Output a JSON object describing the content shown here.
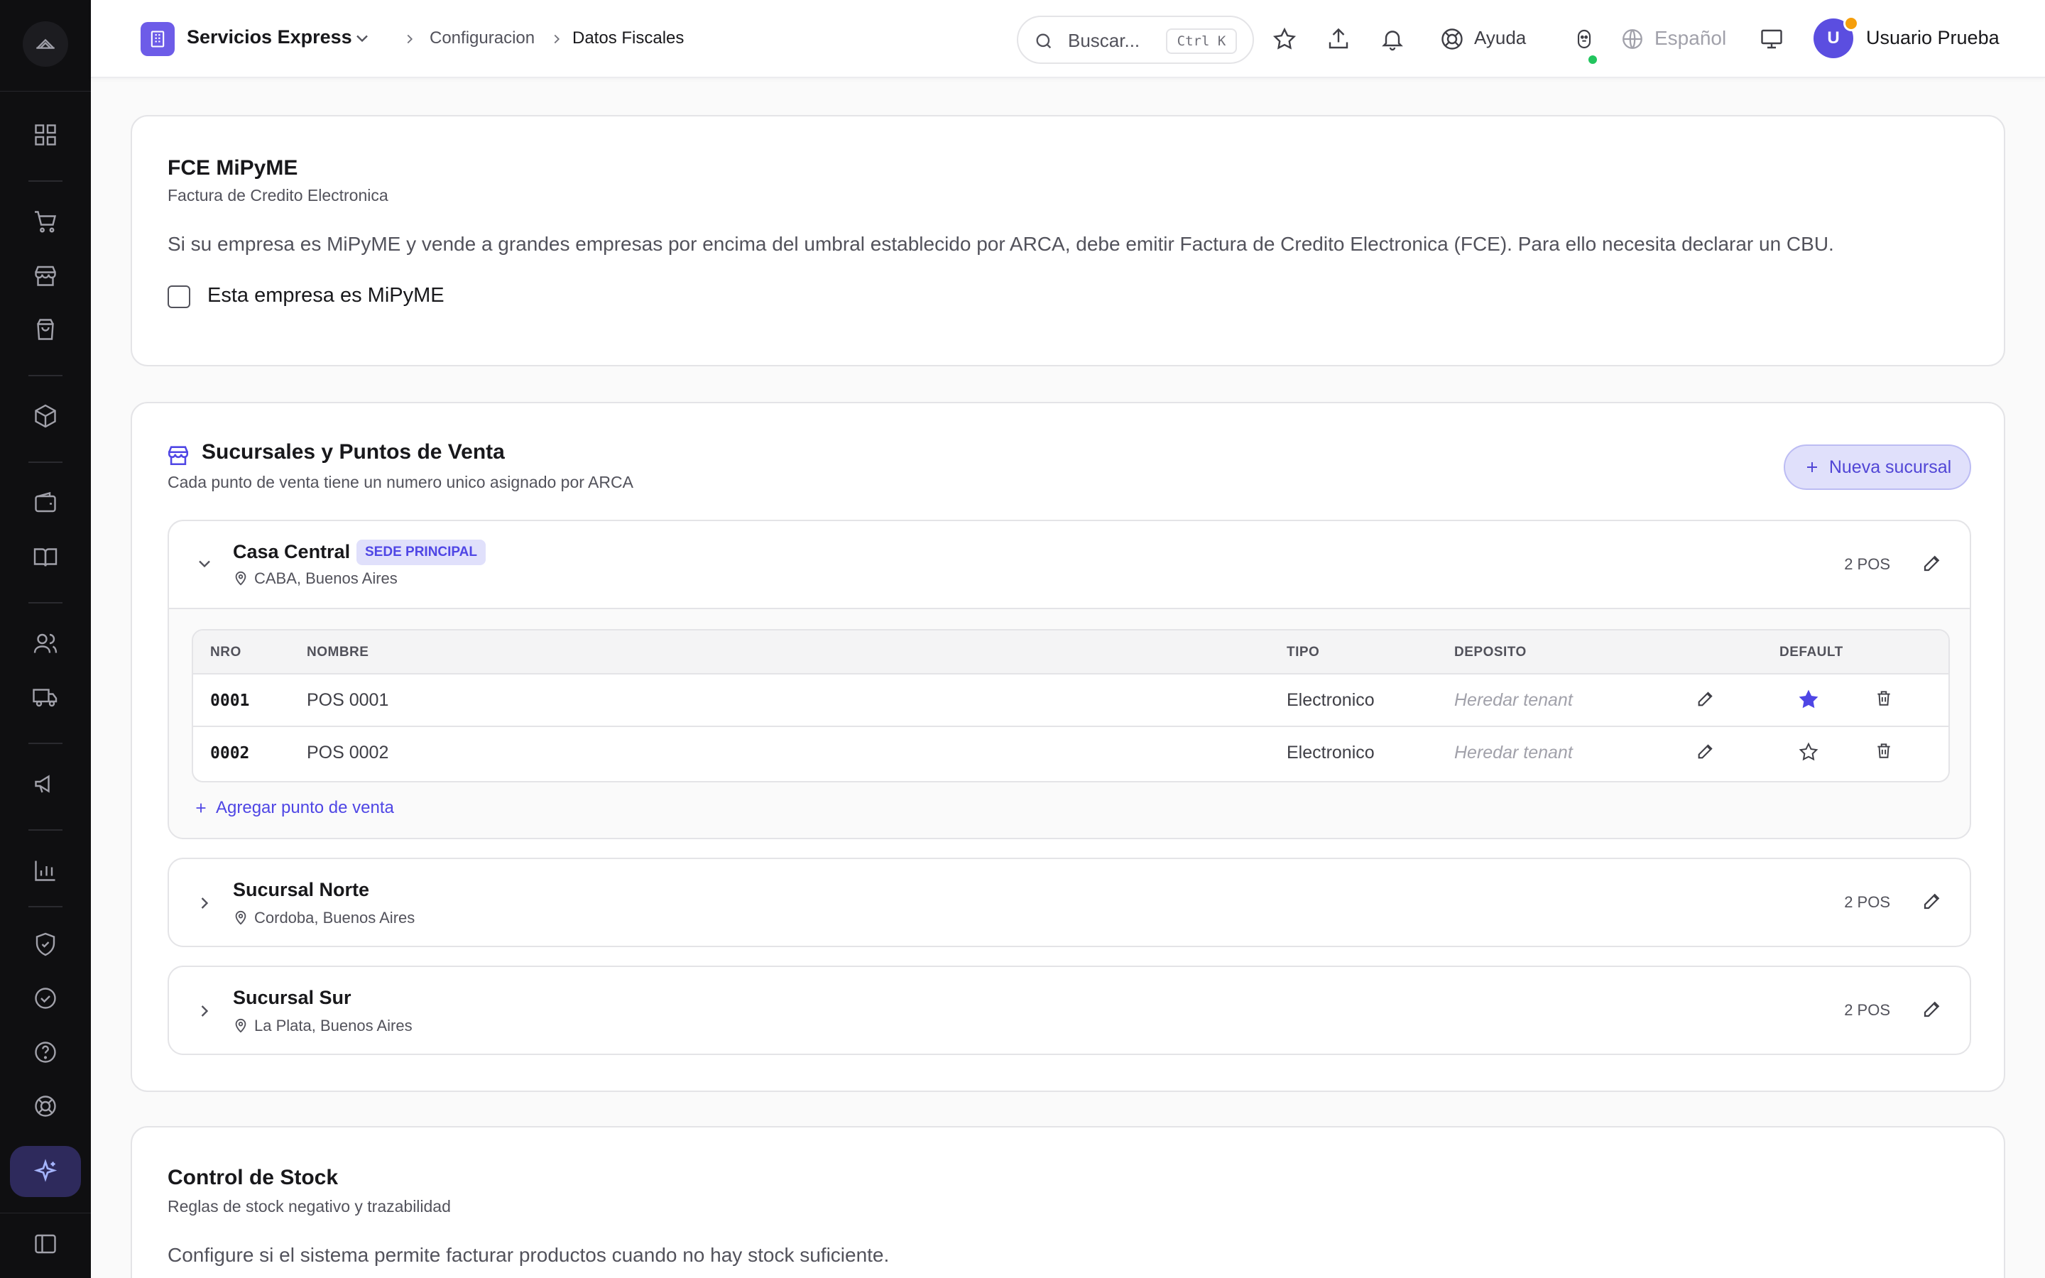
{
  "header": {
    "tenant": "Servicios Express",
    "breadcrumb": [
      "Configuracion",
      "Datos Fiscales"
    ],
    "search_placeholder": "Buscar...",
    "search_shortcut": "Ctrl K",
    "help_label": "Ayuda",
    "language": "Español",
    "user_initial": "U",
    "user_name": "Usuario Prueba"
  },
  "fce": {
    "title": "FCE MiPyME",
    "subtitle": "Factura de Credito Electronica",
    "description": "Si su empresa es MiPyME y vende a grandes empresas por encima del umbral establecido por ARCA, debe emitir Factura de Credito Electronica (FCE). Para ello necesita declarar un CBU.",
    "checkbox_label": "Esta empresa es MiPyME",
    "checked": false
  },
  "branches_section": {
    "title": "Sucursales y Puntos de Venta",
    "subtitle": "Cada punto de venta tiene un numero unico asignado por ARCA",
    "new_button": "Nueva sucursal",
    "table_headers": {
      "nro": "NRO",
      "nombre": "NOMBRE",
      "tipo": "TIPO",
      "deposito": "DEPOSITO",
      "default": "DEFAULT"
    },
    "add_pos_label": "Agregar punto de venta",
    "branches": [
      {
        "name": "Casa Central",
        "badge": "SEDE PRINCIPAL",
        "location": "CABA, Buenos Aires",
        "pos_count": "2 POS",
        "expanded": true,
        "pos": [
          {
            "nro": "0001",
            "nombre": "POS 0001",
            "tipo": "Electronico",
            "deposito": "Heredar tenant",
            "default": true
          },
          {
            "nro": "0002",
            "nombre": "POS 0002",
            "tipo": "Electronico",
            "deposito": "Heredar tenant",
            "default": false
          }
        ]
      },
      {
        "name": "Sucursal Norte",
        "location": "Cordoba, Buenos Aires",
        "pos_count": "2 POS",
        "expanded": false
      },
      {
        "name": "Sucursal Sur",
        "location": "La Plata, Buenos Aires",
        "pos_count": "2 POS",
        "expanded": false
      }
    ]
  },
  "stock": {
    "title": "Control de Stock",
    "subtitle": "Reglas de stock negativo y trazabilidad",
    "description": "Configure si el sistema permite facturar productos cuando no hay stock suficiente."
  },
  "colors": {
    "accent": "#4f46e5",
    "sidebar_bg": "#0f0f11",
    "online": "#22c55e",
    "notification": "#f59e0b"
  }
}
